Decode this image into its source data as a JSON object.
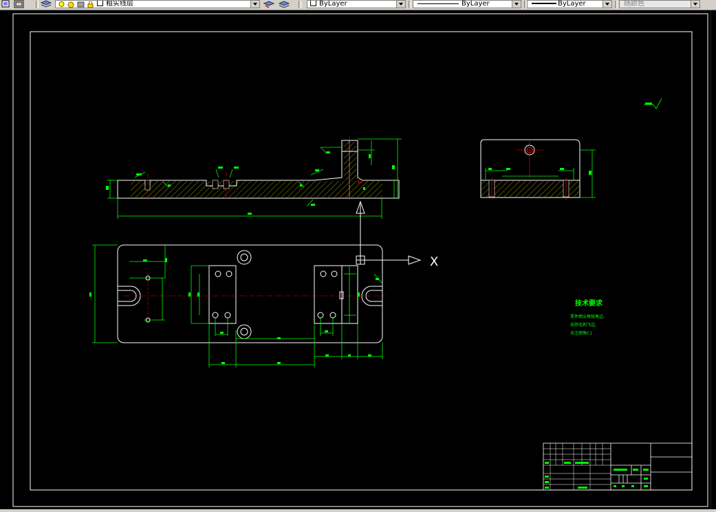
{
  "toolbar": {
    "layer_name": "粗实线层",
    "color_control": "ByLayer",
    "linetype_control": "ByLayer",
    "lineweight_control": "ByLayer",
    "plotstyle_control": "随颜色"
  },
  "drawing": {
    "ucs_axis_label": "X",
    "tech_requirements": {
      "title": "技术要求",
      "lines": [
        "零件倒尖角锐角边,",
        "去除毛刺飞边,",
        "未注倒角C1"
      ]
    }
  },
  "colors": {
    "outline": "#ffffff",
    "dimension": "#00ff00",
    "centerline": "#ff0000",
    "hatch": "#ffff00",
    "background": "#000000",
    "toolbar": "#d4d0c8"
  }
}
